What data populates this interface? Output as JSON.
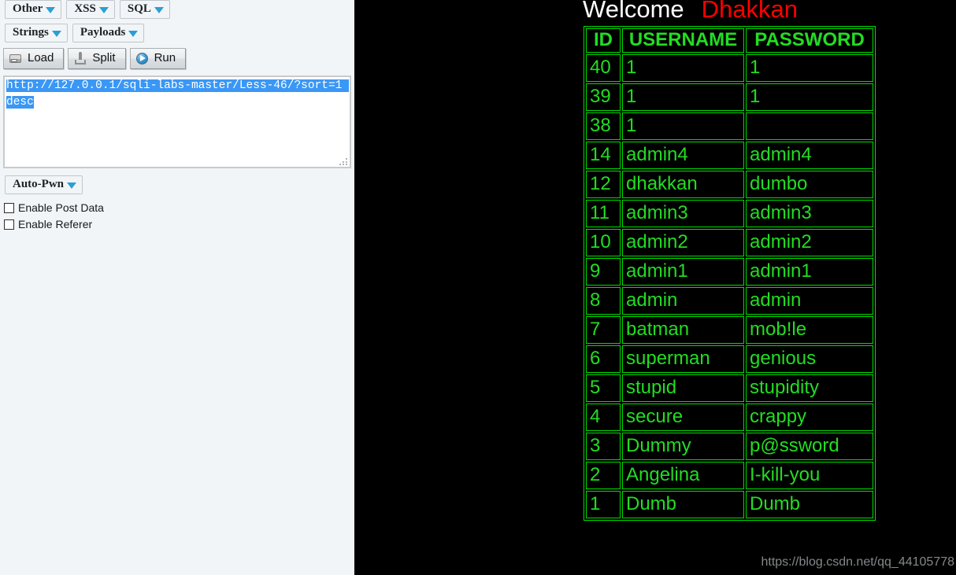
{
  "toolbar": {
    "dropdowns_row1": [
      {
        "label": "Other",
        "name": "dropdown-other"
      },
      {
        "label": "XSS",
        "name": "dropdown-xss"
      },
      {
        "label": "SQL",
        "name": "dropdown-sql"
      }
    ],
    "dropdowns_row2": [
      {
        "label": "Strings",
        "name": "dropdown-strings"
      },
      {
        "label": "Payloads",
        "name": "dropdown-payloads"
      }
    ],
    "actions": [
      {
        "label": "Load",
        "icon": "drive-icon"
      },
      {
        "label": "Split",
        "icon": "screwdriver-icon"
      },
      {
        "label": "Run",
        "icon": "play-circle-icon"
      }
    ],
    "auto_pwn": {
      "label": "Auto-Pwn"
    },
    "caret_color": "#2b9fd4"
  },
  "url_input": {
    "value": "http://127.0.0.1/sqli-labs-master/Less-46/?sort=1 desc",
    "selected_text": "http://127.0.0.1/sqli-labs-master/Less-46/?sort=1 desc",
    "placeholder": "",
    "selection_color": "#3a97f5"
  },
  "checkboxes": [
    {
      "label": "Enable Post Data",
      "checked": false
    },
    {
      "label": "Enable Referer",
      "checked": false
    }
  ],
  "result": {
    "welcome_word": "Welcome",
    "user_name": "Dhakkan",
    "welcome_color": "#ffffff",
    "user_color": "#ff0000",
    "table_color": "#22dd22",
    "background": "#000000",
    "columns": [
      "ID",
      "USERNAME",
      "PASSWORD"
    ],
    "rows": [
      {
        "id": "40",
        "username": "1",
        "password": "1"
      },
      {
        "id": "39",
        "username": "1",
        "password": "1"
      },
      {
        "id": "38",
        "username": "1",
        "password": ""
      },
      {
        "id": "14",
        "username": "admin4",
        "password": "admin4"
      },
      {
        "id": "12",
        "username": "dhakkan",
        "password": "dumbo"
      },
      {
        "id": "11",
        "username": "admin3",
        "password": "admin3"
      },
      {
        "id": "10",
        "username": "admin2",
        "password": "admin2"
      },
      {
        "id": "9",
        "username": "admin1",
        "password": "admin1"
      },
      {
        "id": "8",
        "username": "admin",
        "password": "admin"
      },
      {
        "id": "7",
        "username": "batman",
        "password": "mob!le"
      },
      {
        "id": "6",
        "username": "superman",
        "password": "genious"
      },
      {
        "id": "5",
        "username": "stupid",
        "password": "stupidity"
      },
      {
        "id": "4",
        "username": "secure",
        "password": "crappy"
      },
      {
        "id": "3",
        "username": "Dummy",
        "password": "p@ssword"
      },
      {
        "id": "2",
        "username": "Angelina",
        "password": "I-kill-you"
      },
      {
        "id": "1",
        "username": "Dumb",
        "password": "Dumb"
      }
    ]
  },
  "watermark": {
    "text": "https://blog.csdn.net/qq_44105778"
  }
}
